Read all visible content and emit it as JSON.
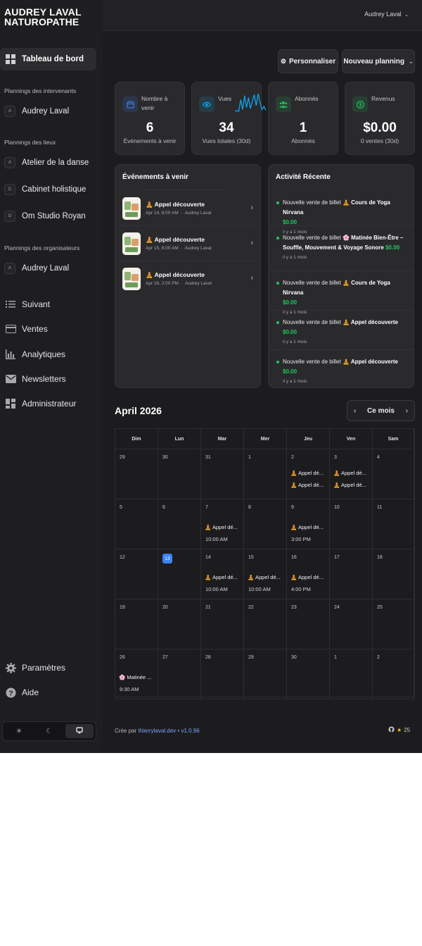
{
  "brand": {
    "line1": "AUDREY LAVAL",
    "line2": "NATUROPATHE"
  },
  "header": {
    "user": "Audrey Laval"
  },
  "sidebar": {
    "dashboard_label": "Tableau de bord",
    "section_intervenants": "Plannings des intervenants",
    "intervenants": [
      {
        "badge": "A",
        "label": "Audrey Laval"
      }
    ],
    "section_lieux": "Plannings des lieux",
    "lieux": [
      {
        "badge": "A",
        "label": "Atelier de la danse"
      },
      {
        "badge": "C",
        "label": "Cabinet holistique"
      },
      {
        "badge": "O",
        "label": "Om Studio Royan"
      }
    ],
    "section_organisateurs": "Plannings des organisateurs",
    "organisateurs": [
      {
        "badge": "A",
        "label": "Audrey Laval"
      }
    ],
    "menu": [
      "Suivant",
      "Ventes",
      "Analytiques",
      "Newsletters",
      "Administrateur"
    ],
    "settings_label": "Paramètres",
    "help_label": "Aide"
  },
  "toolbar": {
    "customize_label": "Personnaliser",
    "new_planning_label": "Nouveau planning"
  },
  "stats": [
    {
      "label": "Nombre à venir",
      "value": "6",
      "sub": "Événements à venir",
      "icon": "calendar-icon",
      "color": "#3b82f6"
    },
    {
      "label": "Vues",
      "value": "34",
      "sub": "Vues totales (30d)",
      "icon": "eye-icon",
      "color": "#0ea5e9"
    },
    {
      "label": "Abonnés",
      "value": "1",
      "sub": "Abonnés",
      "icon": "users-icon",
      "color": "#22c55e"
    },
    {
      "label": "Revenus",
      "value": "$0.00",
      "sub": "0 ventes (30d)",
      "icon": "dollar-icon",
      "color": "#22c55e"
    }
  ],
  "sparkline": [
    0.1,
    0.15,
    0.1,
    0.7,
    0.2,
    0.9,
    0.3,
    0.8,
    0.25,
    0.6,
    0.95,
    0.4,
    1.0,
    0.55,
    0.2,
    0.35,
    0.15
  ],
  "upcoming": {
    "title": "Événements à venir",
    "events": [
      {
        "title": "🧘 Appel découverte",
        "date": "Apr 14, 8:00 AM",
        "host": "Audrey Laval"
      },
      {
        "title": "🧘 Appel découverte",
        "date": "Apr 15, 8:00 AM",
        "host": "Audrey Laval"
      },
      {
        "title": "🧘 Appel découverte",
        "date": "Apr 16, 2:00 PM",
        "host": "Audrey Laval"
      }
    ]
  },
  "activity": {
    "title": "Activité Récente",
    "items": [
      {
        "prefix": "Nouvelle vente de billet",
        "event": "🧘 Cours de Yoga Nirvana",
        "amount": "$0.00",
        "time": "il y a 1 mois"
      },
      {
        "prefix": "Nouvelle vente de billet",
        "event": "🌸 Matinée Bien-Être – Souffle, Mouvement & Voyage Sonore",
        "amount": "$0.00",
        "time": "il y a 1 mois"
      },
      {
        "prefix": "Nouvelle vente de billet",
        "event": "🧘 Cours de Yoga Nirvana",
        "amount": "$0.00",
        "time": "il y a 1 mois"
      },
      {
        "prefix": "Nouvelle vente de billet",
        "event": "🧘 Appel découverte",
        "amount": "$0.00",
        "time": "il y a 1 mois"
      },
      {
        "prefix": "Nouvelle vente de billet",
        "event": "🧘 Appel découverte",
        "amount": "$0.00",
        "time": "il y a 1 mois"
      }
    ]
  },
  "calendar": {
    "month_title": "April 2026",
    "current_month_label": "Ce mois",
    "weekdays": [
      "Dim",
      "Lun",
      "Mar",
      "Mer",
      "Jeu",
      "Ven",
      "Sam"
    ],
    "weeks": [
      [
        {
          "d": "29"
        },
        {
          "d": "30"
        },
        {
          "d": "31"
        },
        {
          "d": "1"
        },
        {
          "d": "2",
          "ev": [
            "🧘 Appel dé...",
            "🧘 Appel dé..."
          ]
        },
        {
          "d": "3",
          "ev": [
            "🧘 Appel dé...",
            "🧘 Appel dé..."
          ]
        },
        {
          "d": "4"
        }
      ],
      [
        {
          "d": "5"
        },
        {
          "d": "6"
        },
        {
          "d": "7",
          "ev": [
            "🧘 Appel dé..."
          ],
          "t": "10:00 AM"
        },
        {
          "d": "8"
        },
        {
          "d": "9",
          "ev": [
            "🧘 Appel dé..."
          ],
          "t": "3:00 PM"
        },
        {
          "d": "10"
        },
        {
          "d": "11"
        }
      ],
      [
        {
          "d": "12"
        },
        {
          "d": "13",
          "today": true
        },
        {
          "d": "14",
          "ev": [
            "🧘 Appel dé..."
          ],
          "t": "10:00 AM"
        },
        {
          "d": "15",
          "ev": [
            "🧘 Appel dé..."
          ],
          "t": "10:00 AM"
        },
        {
          "d": "16",
          "ev": [
            "🧘 Appel dé..."
          ],
          "t": "4:00 PM"
        },
        {
          "d": "17"
        },
        {
          "d": "18"
        }
      ],
      [
        {
          "d": "19"
        },
        {
          "d": "20"
        },
        {
          "d": "21"
        },
        {
          "d": "22"
        },
        {
          "d": "23"
        },
        {
          "d": "24"
        },
        {
          "d": "25"
        }
      ],
      [
        {
          "d": "26",
          "ev": [
            "🌸 Matinée ..."
          ],
          "t": "9:30 AM"
        },
        {
          "d": "27"
        },
        {
          "d": "28"
        },
        {
          "d": "29"
        },
        {
          "d": "30"
        },
        {
          "d": "1"
        },
        {
          "d": "2"
        }
      ]
    ]
  },
  "footer": {
    "prefix": "Crée par",
    "link": "thierrylaval.dev",
    "sep": "•",
    "version": "v1.0.96",
    "stars": "25"
  }
}
